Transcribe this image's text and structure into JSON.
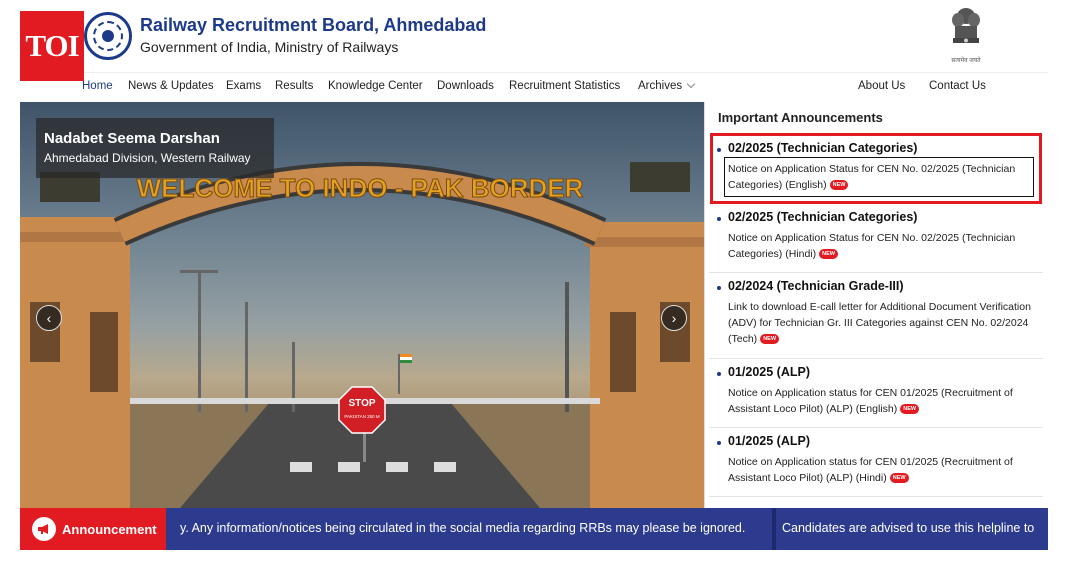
{
  "header": {
    "toi_logo": "TOI",
    "title": "Railway Recruitment Board, Ahmedabad",
    "subtitle": "Government of India, Ministry of Railways",
    "emblem_caption": "सत्यमेव जयते"
  },
  "nav": {
    "items": [
      "Home",
      "News & Updates",
      "Exams",
      "Results",
      "Knowledge Center",
      "Downloads",
      "Recruitment Statistics",
      "Archives"
    ],
    "right_items": [
      "About Us",
      "Contact Us"
    ],
    "active": "Home"
  },
  "banner": {
    "title": "Nadabet Seema Darshan",
    "subtitle": "Ahmedabad Division, Western Railway",
    "arch_text": "WELCOME TO INDO - PAK BORDER",
    "stop_sign": "STOP",
    "stop_sub": "PAKISTAN 250 M"
  },
  "announcements": {
    "heading": "Important Announcements",
    "new_badge": "NEW",
    "items": [
      {
        "title": "02/2025 (Technician Categories)",
        "body": "Notice on Application Status for CEN No. 02/2025 (Technician Categories) (English)"
      },
      {
        "title": "02/2025 (Technician Categories)",
        "body": "Notice on Application Status for CEN No. 02/2025 (Technician Categories) (Hindi)"
      },
      {
        "title": "02/2024 (Technician Grade-III)",
        "body": "Link to download E-call letter for Additional Document Verification (ADV) for Technician Gr. III Categories against CEN No. 02/2024 (Tech)"
      },
      {
        "title": "01/2025 (ALP)",
        "body": "Notice on Application status for CEN 01/2025 (Recruitment of Assistant Loco Pilot) (ALP) (English)"
      },
      {
        "title": "01/2025 (ALP)",
        "body": "Notice on Application status for CEN 01/2025 (Recruitment of Assistant Loco Pilot) (ALP) (Hindi)"
      }
    ]
  },
  "ticker": {
    "label": "Announcement",
    "text1": "y. Any information/notices being circulated in the social media regarding RRBs may please be ignored.",
    "text2": "Candidates are advised to use this helpline to"
  },
  "colors": {
    "brand_blue": "#1d3a8a",
    "accent_red": "#e21b22",
    "ticker_bg": "#2d3b8f"
  }
}
